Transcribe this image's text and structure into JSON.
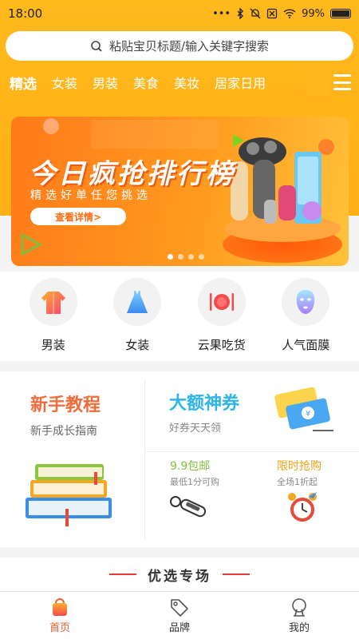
{
  "status_bar": {
    "time": "18:00",
    "battery": "99%",
    "battery_level": 0.99
  },
  "search": {
    "placeholder": "粘贴宝贝标题/输入关键字搜索"
  },
  "categories": [
    "精选",
    "女装",
    "男装",
    "美食",
    "美妆",
    "居家日用"
  ],
  "banner": {
    "title": "今日疯抢排行榜",
    "subtitle": "精选好单任您挑选",
    "button": "查看详情>",
    "page_count": 4,
    "current_page": 1
  },
  "quick_icons": [
    {
      "label": "男装",
      "icon": "mens-jacket-icon"
    },
    {
      "label": "女装",
      "icon": "dress-icon"
    },
    {
      "label": "云果吃货",
      "icon": "dinner-plate-icon"
    },
    {
      "label": "人气面膜",
      "icon": "face-mask-icon"
    }
  ],
  "promos": {
    "tutorial": {
      "title": "新手教程",
      "subtitle": "新手成长指南"
    },
    "coupon": {
      "title": "大额神券",
      "subtitle": "好券天天领"
    },
    "cheap": {
      "title": "9.9包邮",
      "subtitle": "最低1分可购"
    },
    "flash": {
      "title": "限时抢购",
      "subtitle": "全场1折起"
    }
  },
  "section": {
    "title": "优选专场"
  },
  "tabbar": [
    {
      "label": "首页",
      "icon": "shopping-bag-icon",
      "active": true
    },
    {
      "label": "品牌",
      "icon": "tag-icon",
      "active": false
    },
    {
      "label": "我的",
      "icon": "profile-icon",
      "active": false
    }
  ],
  "colors": {
    "theme": "#ffb71d",
    "accent": "#f75b2a"
  }
}
